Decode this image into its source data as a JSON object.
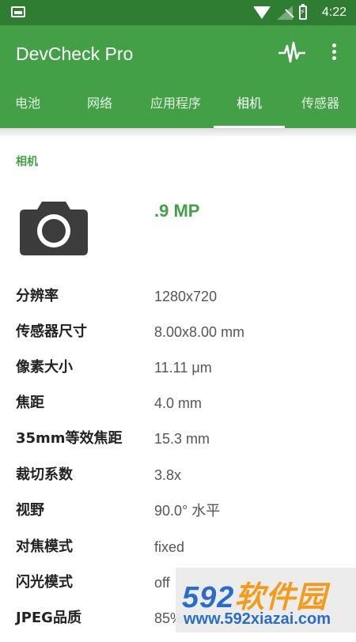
{
  "status_bar": {
    "time": "4:22",
    "icons": [
      "notification-icon",
      "wifi-icon",
      "signal-icon",
      "battery-charging-icon"
    ]
  },
  "app_bar": {
    "title": "DevCheck Pro",
    "icons": [
      "pulse-icon",
      "more-vert-icon"
    ]
  },
  "tabs": [
    {
      "label": "电池"
    },
    {
      "label": "网络"
    },
    {
      "label": "应用程序"
    },
    {
      "label": "相机",
      "active": true
    },
    {
      "label": "传感器"
    }
  ],
  "section": {
    "title": "相机",
    "camera_icon": "camera-icon",
    "megapixels": ".9 MP"
  },
  "rows": [
    {
      "label": "分辨率",
      "value": "1280x720"
    },
    {
      "label": "传感器尺寸",
      "value": "8.00x8.00 mm"
    },
    {
      "label": "像素大小",
      "value": "11.11 μm"
    },
    {
      "label": "焦距",
      "value": "4.0 mm"
    },
    {
      "label": "35mm等效焦距",
      "value": "15.3 mm"
    },
    {
      "label": "裁切系数",
      "value": "3.8x"
    },
    {
      "label": "视野",
      "value": "90.0° 水平"
    },
    {
      "label": "对焦模式",
      "value": "fixed"
    },
    {
      "label": "闪光模式",
      "value": "off"
    },
    {
      "label": "JPEG品质",
      "value": "85%"
    }
  ],
  "watermark": {
    "main_a": "592",
    "main_b": "软件园",
    "sub": "www.592xiazai.com"
  },
  "colors": {
    "primary": "#43a047",
    "primary_dark": "#2e7d32",
    "accent_text": "#43a047"
  }
}
